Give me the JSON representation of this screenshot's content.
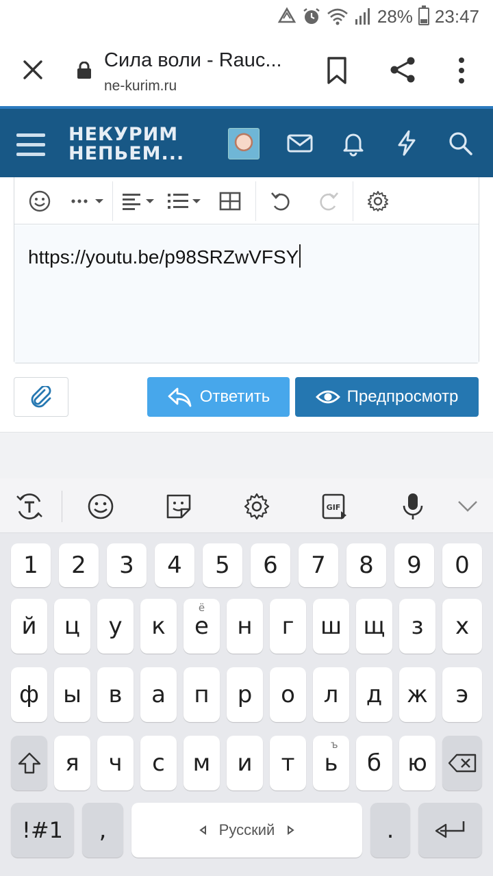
{
  "status_bar": {
    "battery": "28%",
    "time": "23:47"
  },
  "browser": {
    "title": "Сила воли - Rauc...",
    "url": "ne-kurim.ru"
  },
  "site": {
    "logo_line1": "НЕКУРИМ",
    "logo_line2": "НЕПЬЕМ..."
  },
  "editor": {
    "content": "https://youtu.be/p98SRZwVFSY"
  },
  "actions": {
    "reply": "Ответить",
    "preview": "Предпросмотр"
  },
  "keyboard": {
    "row_numbers": [
      "1",
      "2",
      "3",
      "4",
      "5",
      "6",
      "7",
      "8",
      "9",
      "0"
    ],
    "row1": [
      "й",
      "ц",
      "у",
      "к",
      "е",
      "н",
      "г",
      "ш",
      "щ",
      "з",
      "х"
    ],
    "row1_sup_e": "ё",
    "row2": [
      "ф",
      "ы",
      "в",
      "а",
      "п",
      "р",
      "о",
      "л",
      "д",
      "ж",
      "э"
    ],
    "row3": [
      "я",
      "ч",
      "с",
      "м",
      "и",
      "т",
      "ь",
      "б",
      "ю"
    ],
    "row3_sup_soft": "ъ",
    "symbols": "!#1",
    "comma": ",",
    "space_label": "Русский",
    "period": "."
  },
  "colors": {
    "header": "#185886",
    "reply": "#47a7eb",
    "preview": "#2577b1"
  }
}
